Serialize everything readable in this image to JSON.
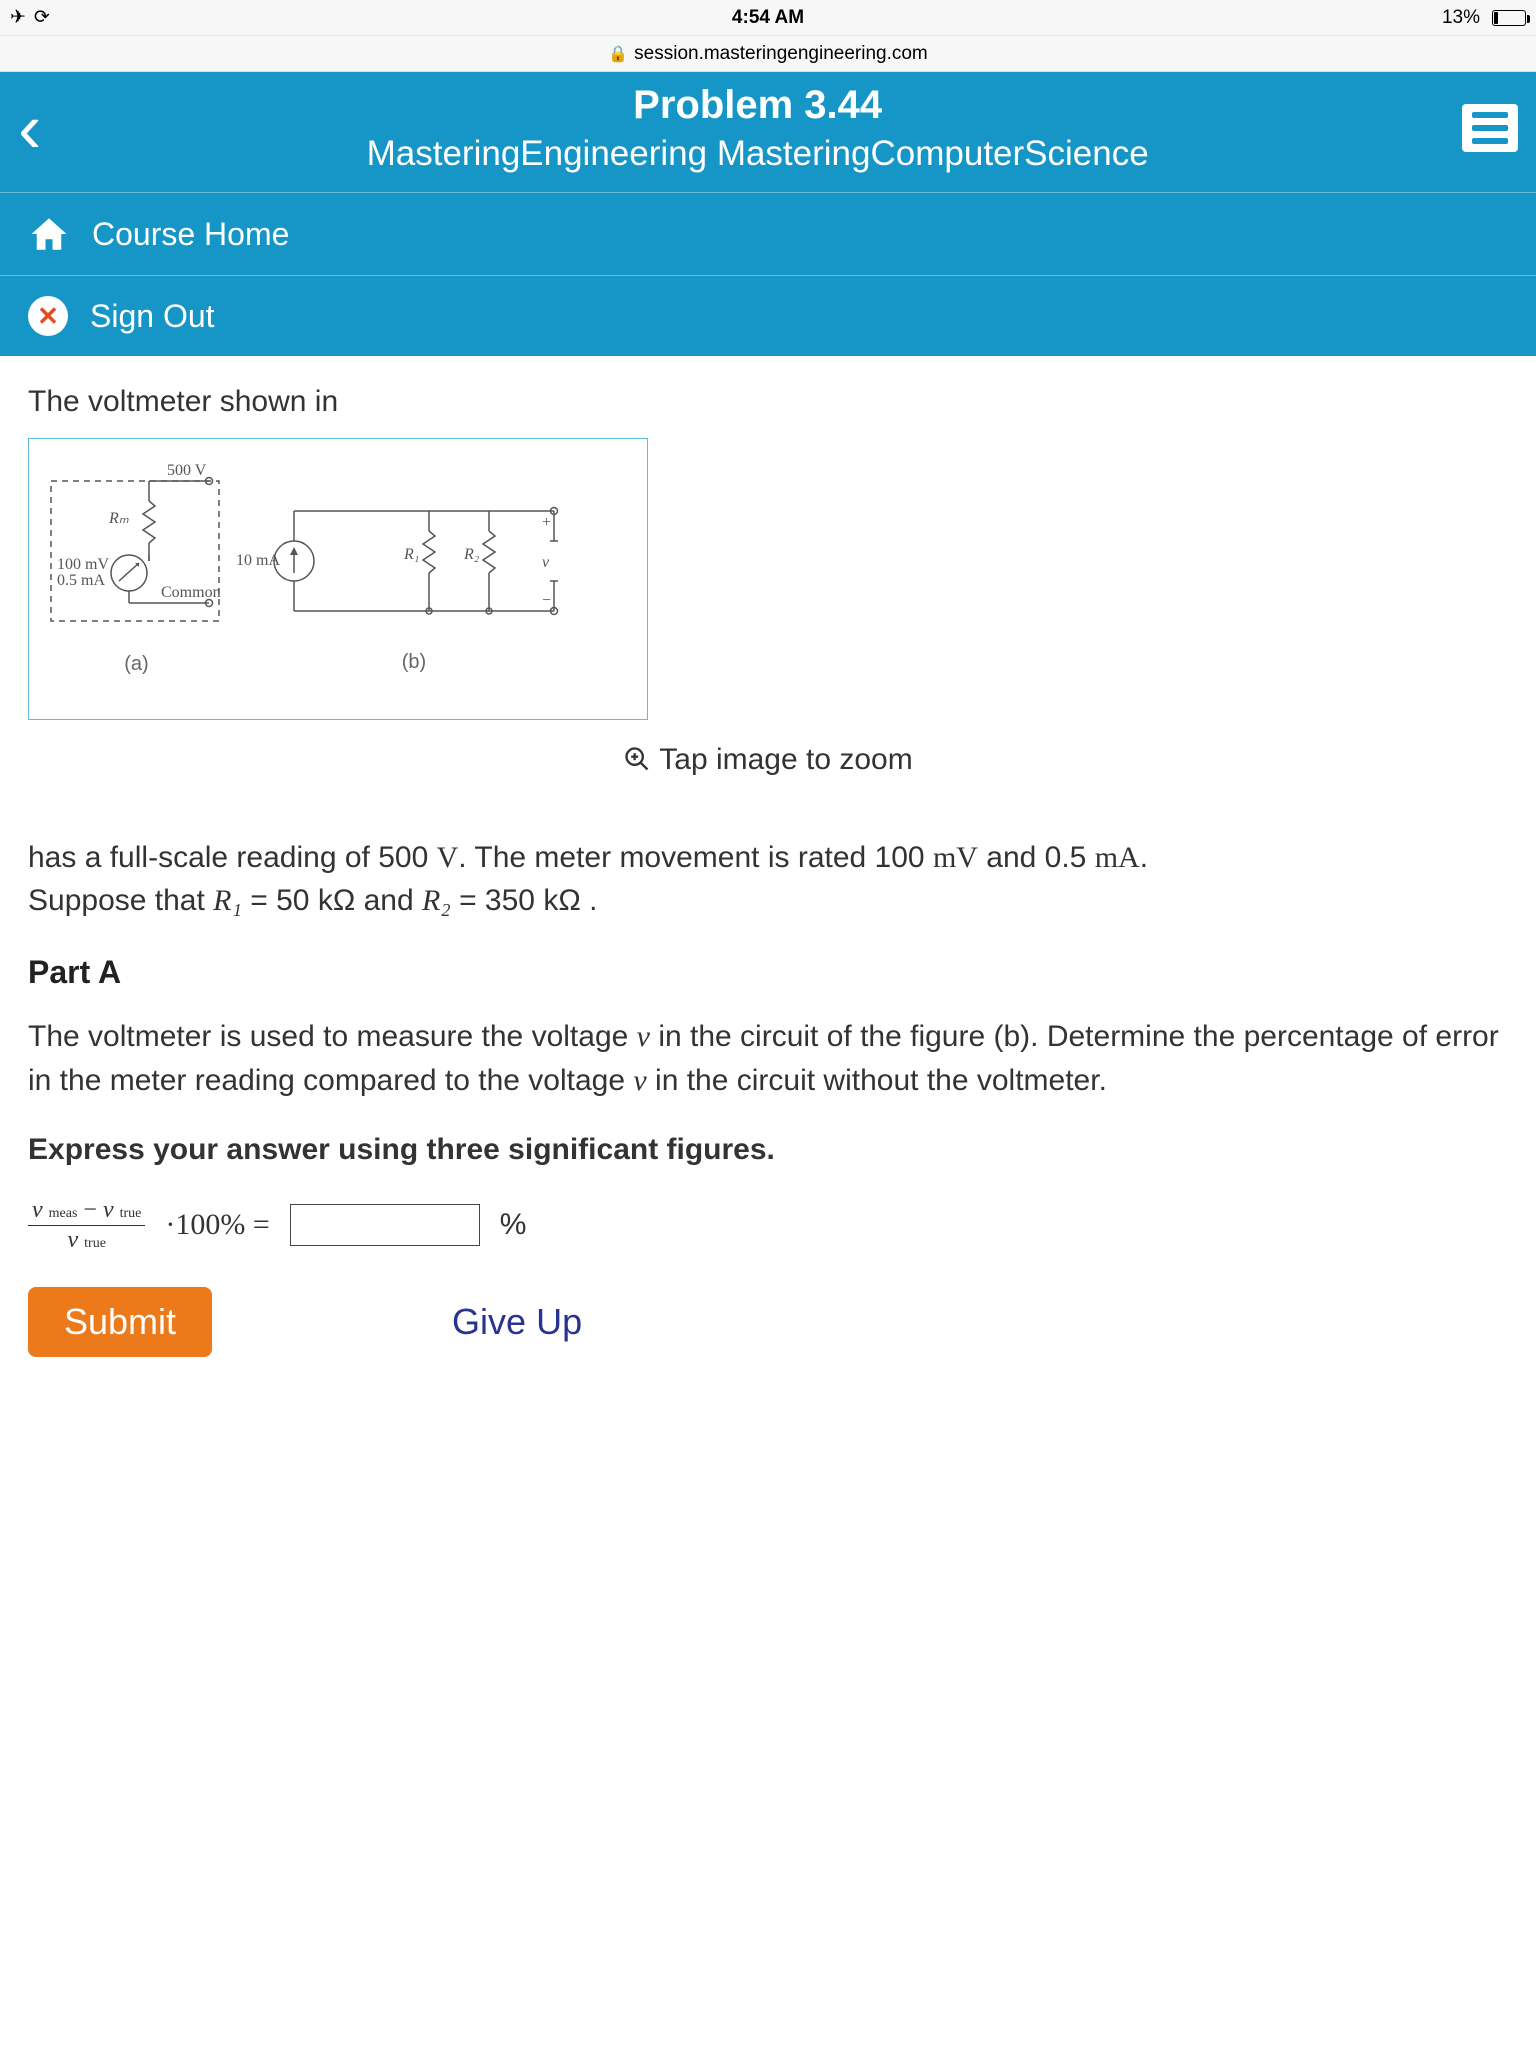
{
  "statusbar": {
    "time": "4:54 AM",
    "battery_pct": "13%",
    "url": "session.masteringengineering.com"
  },
  "header": {
    "problem_title": "Problem 3.44",
    "course_title": "MasteringEngineering MasteringComputerScience"
  },
  "nav": {
    "course_home": "Course Home",
    "sign_out": "Sign Out"
  },
  "problem": {
    "lead": "The voltmeter shown in",
    "figure": {
      "a": {
        "top_scale": "500 V",
        "rm": "Rₘ",
        "meter_v": "100 mV",
        "meter_i": "0.5 mA",
        "common": "Common",
        "caption": "(a)"
      },
      "b": {
        "source": "10 mA",
        "r1": "R₁",
        "r2": "R₂",
        "v": "v",
        "plus": "+",
        "minus": "−",
        "caption": "(b)"
      }
    },
    "zoom_hint": "Tap image to zoom",
    "body1_prefix": "has a full-scale reading of 500 ",
    "body1_unit1": "V",
    "body1_mid": ". The meter movement is rated 100 ",
    "body1_unit2": "mV",
    "body1_mid2": " and 0.5 ",
    "body1_unit3": "mA",
    "body1_suffix": ".",
    "body2_prefix": "Suppose that ",
    "body2_r1": "R₁",
    "body2_eq1": " = 50  kΩ and ",
    "body2_r2": "R₂",
    "body2_eq2": " = 350  kΩ .",
    "part_label": "Part A",
    "partA_1": "The voltmeter is used to measure the voltage ",
    "partA_v": "v",
    "partA_2": " in the circuit of the figure (b). Determine the percentage of error in the meter reading compared to the voltage ",
    "partA_3": " in the circuit without the voltmeter.",
    "instruct": "Express your answer using three significant figures.",
    "eq": {
      "num_l": "v",
      "num_l_sub": "meas",
      "minus": "−",
      "num_r": "v",
      "num_r_sub": "true",
      "den": "v",
      "den_sub": "true",
      "times": "·100% =",
      "unit": "%"
    },
    "submit": "Submit",
    "giveup": "Give Up"
  }
}
